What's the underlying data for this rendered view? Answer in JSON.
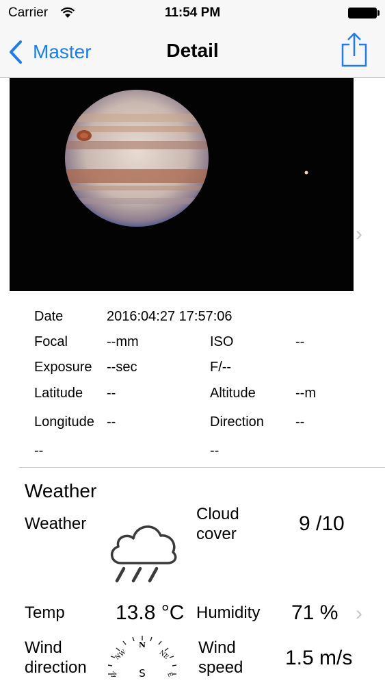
{
  "status_bar": {
    "carrier": "Carrier",
    "time": "11:54 PM"
  },
  "nav": {
    "back_label": "Master",
    "title": "Detail"
  },
  "icons": {
    "back": "chevron-left-icon",
    "share": "share-icon",
    "wifi": "wifi-icon",
    "battery": "battery-icon",
    "weather": "cloud-rain-icon",
    "compass": "compass-icon",
    "disclosure": "chevron-right-icon"
  },
  "colors": {
    "accent": "#1a7cf6",
    "disclosure": "#c7c7cc"
  },
  "exif": {
    "date_label": "Date",
    "date_value": "2016:04:27 17:57:06",
    "focal_label": "Focal",
    "focal_value": "--mm",
    "iso_label": "ISO",
    "iso_value": "--",
    "exposure_label": "Exposure",
    "exposure_value": "--sec",
    "fnumber_value": "F/--",
    "latitude_label": "Latitude",
    "latitude_value": "--",
    "altitude_label": "Altitude",
    "altitude_value": "--m",
    "longitude_label": "Longitude",
    "longitude_value": "--",
    "direction_label": "Direction",
    "direction_value": "--",
    "extra_left": "--",
    "extra_right": "--"
  },
  "weather": {
    "heading": "Weather",
    "weather_label": "Weather",
    "cloud_label_1": "Cloud",
    "cloud_label_2": "cover",
    "cloud_value": "9 /10",
    "temp_label": "Temp",
    "temp_value": "13.8 °C",
    "humidity_label": "Humidity",
    "humidity_value": "71 %",
    "wind_dir_label_1": "Wind",
    "wind_dir_label_2": "direction",
    "wind_speed_label_1": "Wind",
    "wind_speed_label_2": "speed",
    "wind_speed_value": "1.5 m/s",
    "compass": {
      "n": "N",
      "nw": "NW",
      "ne": "NE",
      "s": "S",
      "w": "W",
      "e": "E"
    }
  }
}
